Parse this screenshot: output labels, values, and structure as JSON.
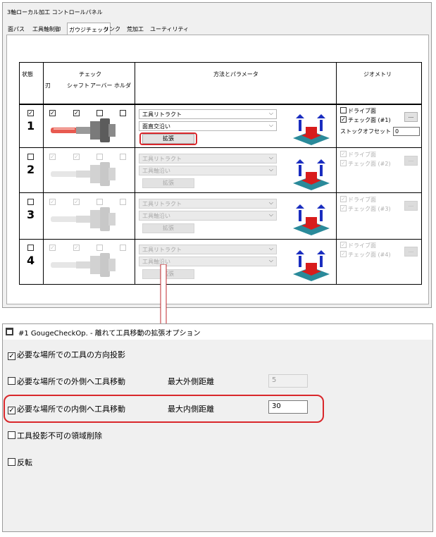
{
  "control_panel": {
    "title": "3軸ローカル加工 コントロールパネル",
    "tabs": [
      "面パス",
      "工具軸制御",
      "ガウジチェック",
      "リンク",
      "荒加工",
      "ユーティリティ"
    ],
    "active_tab": "ガウジチェック",
    "headers": {
      "state": "状態",
      "check": "チェック",
      "blade": "刃",
      "shaft": "シャフト",
      "arbor": "アーバー",
      "holder": "ホルダ",
      "method": "方法とパラメータ",
      "geometry": "ジオメトリ"
    },
    "rows": [
      {
        "number": "1",
        "enabled": true,
        "state": true,
        "checks": [
          true,
          true,
          false,
          false
        ],
        "method1": "工具リトラクト",
        "method2": "面直交沿い",
        "expand": "拡張",
        "drive_face": "ドライブ面",
        "drive_checked": false,
        "check_face": "チェック面 (#1)",
        "check_checked": true,
        "stock_offset_label": "ストックオフセット",
        "stock_offset_value": "0",
        "button": "..."
      },
      {
        "number": "2",
        "enabled": false,
        "state": false,
        "checks": [
          true,
          true,
          false,
          false
        ],
        "method1": "工具リトラクト",
        "method2": "工具軸沿い",
        "expand": "拡張",
        "drive_face": "ドライブ面",
        "drive_checked": true,
        "check_face": "チェック面 (#2)",
        "check_checked": true,
        "button": "..."
      },
      {
        "number": "3",
        "enabled": false,
        "state": false,
        "checks": [
          true,
          true,
          false,
          false
        ],
        "method1": "工具リトラクト",
        "method2": "工具軸沿い",
        "expand": "拡張",
        "drive_face": "ドライブ面",
        "drive_checked": true,
        "check_face": "チェック面 (#3)",
        "check_checked": true,
        "button": "..."
      },
      {
        "number": "4",
        "enabled": false,
        "state": false,
        "checks": [
          true,
          true,
          false,
          false
        ],
        "method1": "工具リトラクト",
        "method2": "工具軸沿い",
        "expand": "拡張",
        "drive_face": "ドライブ面",
        "drive_checked": true,
        "check_face": "チェック面 (#4)",
        "check_checked": true,
        "button": "..."
      }
    ]
  },
  "options_dialog": {
    "title": "#1 GougeCheckOp. - 離れて工具移動の拡張オプション",
    "options": [
      {
        "label": "必要な場所での工具の方向投影",
        "checked": true
      },
      {
        "label": "必要な場所での外側へ工具移動",
        "checked": false,
        "param_label": "最大外側距離",
        "param_value": "5",
        "param_enabled": false
      },
      {
        "label": "必要な場所での内側へ工具移動",
        "checked": true,
        "param_label": "最大内側距離",
        "param_value": "30",
        "param_enabled": true
      },
      {
        "label": "工具投影不可の領域削除",
        "checked": false
      },
      {
        "label": "反転",
        "checked": false
      }
    ]
  },
  "colors": {
    "highlight": "#d9272b",
    "tool_tip_active": "#e85a50",
    "geo_blue": "#1a2dbf",
    "geo_red": "#d81c1c",
    "geo_teal": "#2a8a9a"
  }
}
